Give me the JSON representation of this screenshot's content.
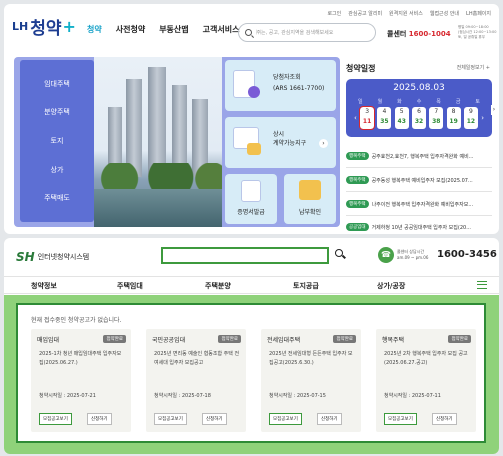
{
  "lh": {
    "top_links": [
      "로그인",
      "관심공고 알리미",
      "원격지원 서비스",
      "웹접근성 안내",
      "LH홈페이지"
    ],
    "logo": {
      "prefix": "LH",
      "name": "청약",
      "plus": "+"
    },
    "nav": [
      "청약",
      "사전청약",
      "부동산맵",
      "고객서비스"
    ],
    "search_placeholder": "㈜는, 공고, 관심지역을 검색해보세요",
    "call_label": "콜센터",
    "call_number": "1600-1004",
    "hours": [
      "평일 09:00~18:00",
      "(점심시간 12:00~13:00",
      "토, 일 공휴일 휴무"
    ],
    "side_menu": [
      "임대주택",
      "분양주택",
      "토지",
      "상가",
      "주택매도"
    ],
    "cards": {
      "winner": [
        "당첨자조회",
        "(ARS 1661-7700)"
      ],
      "store": [
        "상시",
        "계약가능지구"
      ],
      "certificate": "증명서발급",
      "payment": "납부확인"
    },
    "schedule": {
      "title": "청약일정",
      "view_all": "전체일정보기 +",
      "date": "2025.08.03",
      "weekdays": [
        "일",
        "월",
        "화",
        "수",
        "목",
        "금",
        "토"
      ],
      "days": [
        {
          "day": "3",
          "count": "11",
          "color": "#d7282f"
        },
        {
          "day": "4",
          "count": "35",
          "color": "#2e8b36"
        },
        {
          "day": "5",
          "count": "43",
          "color": "#2e8b36"
        },
        {
          "day": "6",
          "count": "32",
          "color": "#2e8b36"
        },
        {
          "day": "7",
          "count": "38",
          "color": "#2e8b36"
        },
        {
          "day": "8",
          "count": "19",
          "color": "#2e8b36"
        },
        {
          "day": "9",
          "count": "12",
          "color": "#2e8b36"
        }
      ],
      "prev_label": "‹",
      "next_label": "›",
      "edge_label": "›",
      "notices": [
        {
          "badge": "행복주택",
          "text": "공주효천2,효천7, 행복주택 입주자격완화 예비..."
        },
        {
          "badge": "행복주택",
          "text": "공주동성 행복주택 예비입주자 모집(2025.07..."
        },
        {
          "badge": "행복주택",
          "text": "나주이전 행복주택 입주자격완화 예비입주자모..."
        },
        {
          "badge": "공공임대",
          "text": "거제하청 10년 공공임대주택 입주자 모집(20..."
        }
      ]
    }
  },
  "sh": {
    "logo_mark": "SH",
    "name": "인터넷청약시스템",
    "call_info": [
      "콜센터 상담시간",
      "am.09 ~ pm.06"
    ],
    "call_number": "1600-3456",
    "nav": [
      "청약정보",
      "주택임대",
      "주택분양",
      "토지공급",
      "상가/공장"
    ],
    "message": "현재 접수중인 청약공고가 없습니다.",
    "announcements": [
      {
        "type": "매입임대",
        "status": "접약완료",
        "desc": "2025-1차 청년 매입임대주택 입주자모집(2025.06.27.)",
        "date": "청약시작일 : 2025-07-21",
        "btn1": "모집공고보기",
        "btn2": "신청하기"
      },
      {
        "type": "국민공공임대",
        "status": "접약완료",
        "desc": "2025년 면리동 예술인 협동조합 주택 전여세대 입주자 모집공고",
        "date": "청약시작일 : 2025-07-18",
        "btn1": "모집공고보기",
        "btn2": "신청하기"
      },
      {
        "type": "전세임대주택",
        "status": "접약완료",
        "desc": "2025년 전세임대형 든든주택 입주자 모집공고(2025.6.30.)",
        "date": "청약시작일 : 2025-07-15",
        "btn1": "모집공고보기",
        "btn2": "신청하기"
      },
      {
        "type": "행복주택",
        "status": "접약완료",
        "desc": "2025년 2차 행복주택 입주자 모집 공고(2025.06.27.공고)",
        "date": "청약시작일 : 2025-07-11",
        "btn1": "모집공고보기",
        "btn2": "신청하기"
      }
    ]
  }
}
